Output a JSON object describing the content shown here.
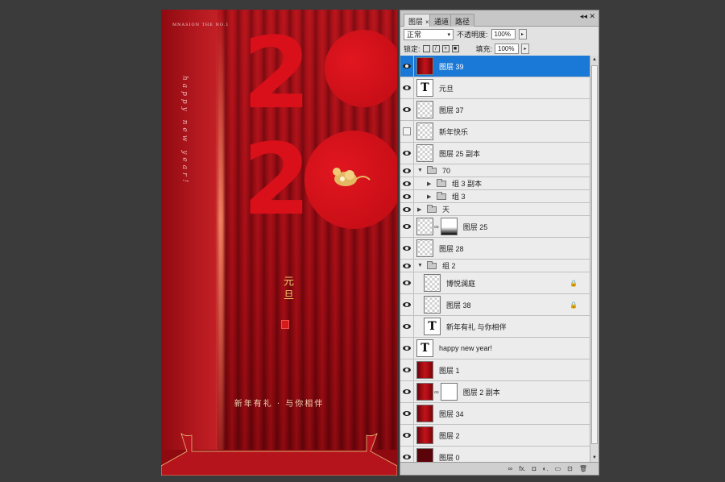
{
  "poster": {
    "brand": "MNASION THE NO.1",
    "script": "happy new year!",
    "digits": [
      "2",
      "2"
    ],
    "title": "元旦",
    "slogan": "新年有礼 · 与你相伴"
  },
  "panel": {
    "tabs": [
      "图层",
      "通道",
      "路径"
    ],
    "tab_close": "×",
    "panel_buttons": "◂◂  ✕",
    "blend_mode": "正常",
    "opacity_label": "不透明度:",
    "opacity_value": "100%",
    "lock_label": "锁定:",
    "fill_label": "填充:",
    "fill_value": "100%",
    "step_arrow": "▸",
    "select_arrow": "▾",
    "scroll_up": "▲",
    "scroll_down": "▼",
    "layers": [
      {
        "name": "图层 39",
        "kind": "big",
        "thumb": "red",
        "visible": true,
        "selected": true
      },
      {
        "name": "元旦",
        "kind": "big",
        "thumb": "text",
        "visible": true
      },
      {
        "name": "图层 37",
        "kind": "big",
        "thumb": "trans",
        "visible": true
      },
      {
        "name": "新年快乐",
        "kind": "big",
        "thumb": "smart",
        "visible": false
      },
      {
        "name": "图层 25 副本",
        "kind": "big",
        "thumb": "trans",
        "visible": true
      },
      {
        "name": "70",
        "kind": "group",
        "visible": true,
        "open": true
      },
      {
        "name": "组 3 副本",
        "kind": "group",
        "visible": true,
        "open": false,
        "indent": 1
      },
      {
        "name": "组 3",
        "kind": "group",
        "visible": true,
        "open": false,
        "indent": 1
      },
      {
        "name": "天",
        "kind": "group",
        "visible": true,
        "open": false
      },
      {
        "name": "图层 25",
        "kind": "big",
        "thumb": "trans",
        "mask": "gradient",
        "visible": true
      },
      {
        "name": "图层 28",
        "kind": "big",
        "thumb": "trans",
        "visible": true
      },
      {
        "name": "组 2",
        "kind": "group",
        "visible": true,
        "open": true
      },
      {
        "name": "博悦澜庭",
        "kind": "big",
        "thumb": "trans",
        "visible": true,
        "indent": 1,
        "locked": true
      },
      {
        "name": "图层 38",
        "kind": "big",
        "thumb": "trans",
        "visible": true,
        "indent": 1,
        "locked": true
      },
      {
        "name": "新年有礼 与你相伴",
        "kind": "big",
        "thumb": "text",
        "visible": true,
        "indent": 1
      },
      {
        "name": "happy new year!",
        "kind": "big",
        "thumb": "text",
        "visible": true
      },
      {
        "name": "图层 1",
        "kind": "big",
        "thumb": "red",
        "visible": true
      },
      {
        "name": "图层 2 副本",
        "kind": "big",
        "thumb": "red",
        "mask": "white",
        "visible": true
      },
      {
        "name": "图层 34",
        "kind": "big",
        "thumb": "red",
        "visible": true
      },
      {
        "name": "图层 2",
        "kind": "big",
        "thumb": "red",
        "visible": true
      },
      {
        "name": "图层 0",
        "kind": "big",
        "thumb": "dark",
        "visible": true
      }
    ],
    "bottom_icons": [
      "link-icon",
      "fx-icon",
      "mask-icon",
      "adjustment-icon",
      "group-icon",
      "new-layer-icon",
      "trash-icon"
    ],
    "bottom_glyphs": [
      "∞",
      "fx.",
      "◘",
      "◐.",
      "▭",
      "⊡",
      "🗑"
    ]
  }
}
